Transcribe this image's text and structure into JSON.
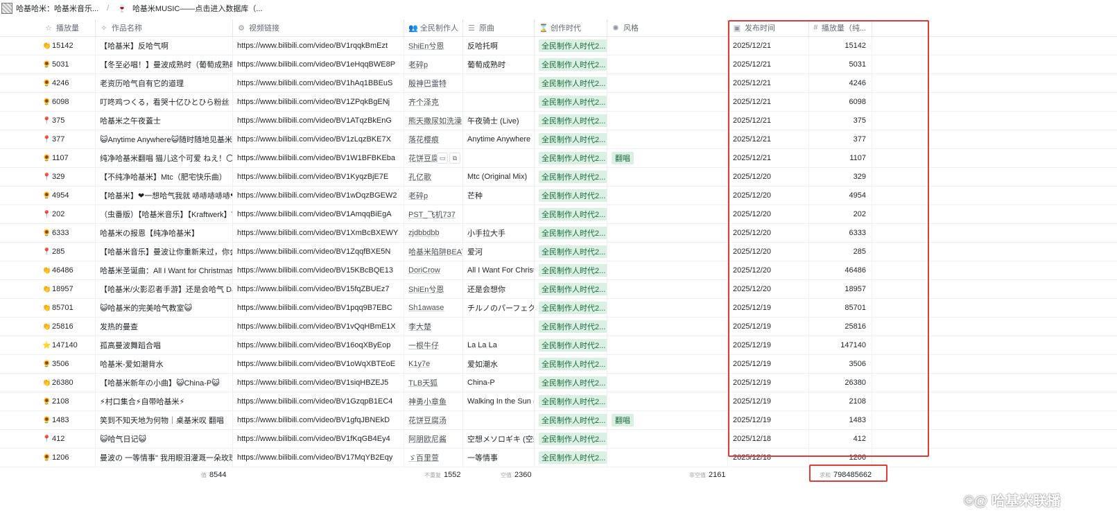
{
  "breadcrumbs": {
    "base_title": "哈基哈米：哈基米音乐...",
    "table_title": "哈基米MUSIC——点击进入数据库（..."
  },
  "columns": {
    "plays": "播放量",
    "title": "作品名称",
    "link": "视频链接",
    "author": "全民制作人",
    "original": "原曲",
    "era": "创作时代",
    "style": "风格",
    "date": "发布时间",
    "views": "播放量（纯..."
  },
  "rows": [
    {
      "medal": "gold",
      "plays": "15142",
      "title": "【哈基米】反哈气啊",
      "link": "https://www.bilibili.com/video/BV1rqqkBmEzt",
      "author": "ShiEn兮恩",
      "original": "反哈托啊",
      "era": "全民制作人时代2...",
      "style": "",
      "date": "2025/12/21",
      "views": "15142"
    },
    {
      "medal": "bronze",
      "plays": "5031",
      "title": "【冬至必唱！】曼波成熟时（葡萄成熟时-R",
      "link": "https://www.bilibili.com/video/BV1eHqqBWE8P",
      "author": "老碎p",
      "original": "葡萄成熟时",
      "era": "全民制作人时代2...",
      "style": "",
      "date": "2025/12/21",
      "views": "5031"
    },
    {
      "medal": "bronze",
      "plays": "4246",
      "title": "老资历哈气自有它的道理",
      "link": "https://www.bilibili.com/video/BV1hAq1BBEuS",
      "author": "殷神巴雷特",
      "original": "",
      "era": "全民制作人时代2...",
      "style": "",
      "date": "2025/12/21",
      "views": "4246"
    },
    {
      "medal": "bronze",
      "plays": "6098",
      "title": "叮咚鸡つくる，看哭十亿ひとひら粉丝",
      "link": "https://www.bilibili.com/video/BV1ZPqkBgENj",
      "author": "齐个泽克",
      "original": "",
      "era": "全民制作人时代2...",
      "style": "",
      "date": "2025/12/21",
      "views": "6098"
    },
    {
      "medal": "pin",
      "plays": "375",
      "title": "哈基米之午夜蓋士",
      "link": "https://www.bilibili.com/video/BV1ATqzBkEnG",
      "author": "熊天撒尿如洗澡",
      "original": "午夜骑士 (Live)",
      "era": "全民制作人时代2...",
      "style": "",
      "date": "2025/12/21",
      "views": "375"
    },
    {
      "medal": "pin",
      "plays": "377",
      "title": "😺Anytime Anywhere😺随时随地见基米",
      "link": "https://www.bilibili.com/video/BV1zLqzBKE7X",
      "author": "落花樱痕",
      "original": "Anytime Anywhere",
      "era": "全民制作人时代2...",
      "style": "",
      "date": "2025/12/21",
      "views": "377"
    },
    {
      "medal": "bronze",
      "plays": "1107",
      "title": "纯净哈基米翻唱 猫儿这个可爱 ねえ！〇〇ね",
      "link": "https://www.bilibili.com/video/BV1W1BFBKEba",
      "author": "花饼豆腐汤",
      "original": "",
      "era": "全民制作人时代2...",
      "style": "翻唱",
      "date": "2025/12/21",
      "views": "1107",
      "hover": true
    },
    {
      "medal": "pin",
      "plays": "329",
      "title": "【不纯净哈基米】Mtc（肥宅快乐曲）",
      "link": "https://www.bilibili.com/video/BV1KyqzBjE7E",
      "author": "孔亿歌",
      "original": "Mtc (Original Mix)",
      "era": "全民制作人时代2...",
      "style": "",
      "date": "2025/12/20",
      "views": "329"
    },
    {
      "medal": "bronze",
      "plays": "4954",
      "title": "【哈基米】❤一想哈气我就 哧哧哧哧哧❤",
      "link": "https://www.bilibili.com/video/BV1wDqzBGEW2",
      "author": "老碎p",
      "original": "芒种",
      "era": "全民制作人时代2...",
      "style": "",
      "date": "2025/12/20",
      "views": "4954"
    },
    {
      "medal": "pin",
      "plays": "202",
      "title": "（虫番版）【哈基米音乐】【Kraftwerk】T",
      "link": "https://www.bilibili.com/video/BV1AmqqBiEgA",
      "author": "PST_飞机737",
      "original": "",
      "era": "全民制作人时代2...",
      "style": "",
      "date": "2025/12/20",
      "views": "202"
    },
    {
      "medal": "bronze",
      "plays": "6333",
      "title": "哈基米の报恩【纯净哈基米】",
      "link": "https://www.bilibili.com/video/BV1XmBcBXEWY",
      "author": "zjdbbdbb",
      "original": "小手拉大手",
      "era": "全民制作人时代2...",
      "style": "",
      "date": "2025/12/20",
      "views": "6333"
    },
    {
      "medal": "pin",
      "plays": "285",
      "title": "【哈基米音乐】曼波让你重新来过，你会不",
      "link": "https://www.bilibili.com/video/BV1ZqqfBXE5N",
      "author": "哈基米陷阱BEAT",
      "original": "爱河",
      "era": "全民制作人时代2...",
      "style": "",
      "date": "2025/12/20",
      "views": "285"
    },
    {
      "medal": "gold",
      "plays": "46486",
      "title": "哈基米圣诞曲：All I Want for Christmas Is",
      "link": "https://www.bilibili.com/video/BV15KBcBQE13",
      "author": "DoriCrow",
      "original": "All I Want For Christm",
      "era": "全民制作人时代2...",
      "style": "",
      "date": "2025/12/20",
      "views": "46486"
    },
    {
      "medal": "gold",
      "plays": "18957",
      "title": "【哈基米/火影忍者手游】还是会哈气 DJ版",
      "link": "https://www.bilibili.com/video/BV15fqZBUEz7",
      "author": "ShiEn兮恩",
      "original": "还是会想你",
      "era": "全民制作人时代2...",
      "style": "",
      "date": "2025/12/20",
      "views": "18957"
    },
    {
      "medal": "gold",
      "plays": "85701",
      "title": "😺哈基米的完美哈气教室😺",
      "link": "https://www.bilibili.com/video/BV1pqq9B7EBC",
      "author": "Sh1awase",
      "original": "チルノのパーフェク",
      "era": "全民制作人时代2...",
      "style": "",
      "date": "2025/12/19",
      "views": "85701"
    },
    {
      "medal": "gold",
      "plays": "25816",
      "title": "发热的曼查",
      "link": "https://www.bilibili.com/video/BV1vQqHBmE1X",
      "author": "李大楚",
      "original": "",
      "era": "全民制作人时代2...",
      "style": "",
      "date": "2025/12/19",
      "views": "25816"
    },
    {
      "medal": "star",
      "plays": "147140",
      "title": "孤高曼波舞蹈合唱",
      "link": "https://www.bilibili.com/video/BV16oqXByEop",
      "author": "一根牛仔",
      "original": "La La La",
      "era": "全民制作人时代2...",
      "style": "",
      "date": "2025/12/19",
      "views": "147140"
    },
    {
      "medal": "bronze",
      "plays": "3506",
      "title": "哈基米-爱如潮背水",
      "link": "https://www.bilibili.com/video/BV1oWqXBTEoE",
      "author": "K1y7e",
      "original": "爱如潮水",
      "era": "全民制作人时代2...",
      "style": "",
      "date": "2025/12/19",
      "views": "3506"
    },
    {
      "medal": "gold",
      "plays": "26380",
      "title": "【哈基米新年の小曲】😺China-P😺",
      "link": "https://www.bilibili.com/video/BV1siqHBZEJ5",
      "author": "TLB天狐",
      "original": "China-P",
      "era": "全民制作人时代2...",
      "style": "",
      "date": "2025/12/19",
      "views": "26380"
    },
    {
      "medal": "bronze",
      "plays": "2108",
      "title": "⚡村口集合⚡自带哈基米⚡",
      "link": "https://www.bilibili.com/video/BV1GzqpB1EC4",
      "author": "神勇小章鱼",
      "original": "Walking In the Sun (D",
      "era": "全民制作人时代2...",
      "style": "",
      "date": "2025/12/19",
      "views": "2108"
    },
    {
      "medal": "bronze",
      "plays": "1483",
      "title": "笑到不知天地为何物｜桌基米叹 翻唱",
      "link": "https://www.bilibili.com/video/BV1gfqJBNEkD",
      "author": "花饼豆腐汤",
      "original": "",
      "era": "全民制作人时代2...",
      "style": "翻唱",
      "date": "2025/12/19",
      "views": "1483"
    },
    {
      "medal": "pin",
      "plays": "412",
      "title": "😺哈气日记😺",
      "link": "https://www.bilibili.com/video/BV1fKqGB4Ey4",
      "author": "阿朋欧尼酱",
      "original": "空想メソロギキ (空想",
      "era": "全民制作人时代2...",
      "style": "",
      "date": "2025/12/18",
      "views": "412"
    },
    {
      "medal": "bronze",
      "plays": "1206",
      "title": "曼波の 一等情事\" 我用眼泪灌溉一朵玫瑰，",
      "link": "https://www.bilibili.com/video/BV17MqYB2Eqy",
      "author": "ゞ百里萱",
      "original": "一等情事",
      "era": "全民制作人时代2...",
      "style": "",
      "date": "2025/12/18",
      "views": "1206"
    }
  ],
  "summary": {
    "plays_label": "值",
    "plays_value": "8544",
    "author_label": "不重复",
    "author_value": "1552",
    "original_label": "空值",
    "original_value": "2360",
    "date_label": "非空值",
    "date_value": "2161",
    "views_label": "求和",
    "views_value": "798485662"
  },
  "watermark": "©@ 哈基米联播",
  "icons": {
    "plays": "star-icon",
    "title": "sparkle-icon",
    "link": "link-icon",
    "author": "people-icon",
    "original": "text-icon",
    "era": "hourglass-icon",
    "style": "style-icon",
    "date": "calendar-icon",
    "views": "hash-icon"
  },
  "colors": {
    "tag_bg": "#d9f0e3",
    "tag_text": "#1c6b3f",
    "highlight": "#e03a3a"
  }
}
